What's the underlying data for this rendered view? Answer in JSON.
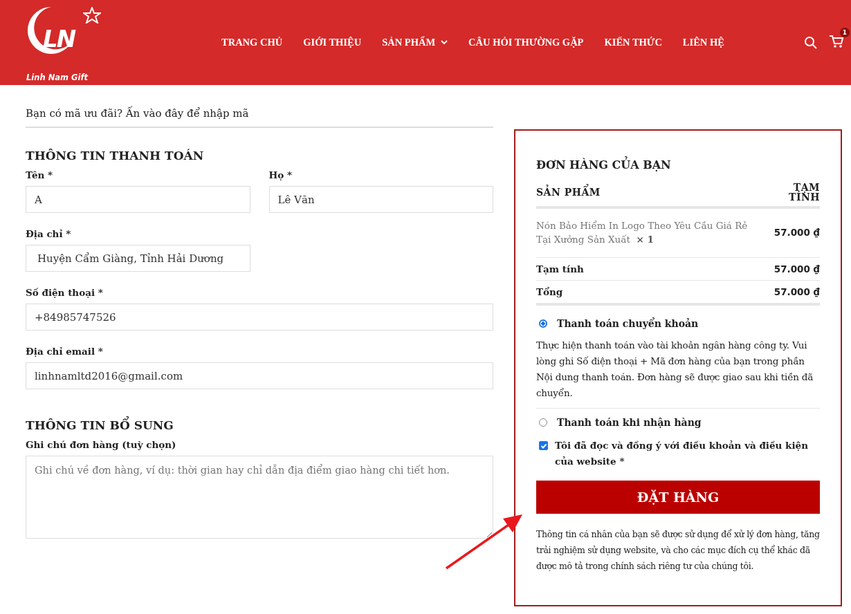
{
  "header": {
    "logo": {
      "mark": "LN",
      "name": "Linh Nam Gift"
    },
    "nav": [
      {
        "label": "TRANG CHỦ",
        "has_dropdown": false
      },
      {
        "label": "GIỚI THIỆU",
        "has_dropdown": false
      },
      {
        "label": "SẢN PHẨM",
        "has_dropdown": true
      },
      {
        "label": "CÂU HỎI THƯỜNG GẶP",
        "has_dropdown": false
      },
      {
        "label": "KIẾN THỨC",
        "has_dropdown": false
      },
      {
        "label": "LIÊN HỆ",
        "has_dropdown": false
      }
    ],
    "cart_count": "1"
  },
  "coupon_notice": "Bạn có mã ưu đãi? Ấn vào đây để nhập mã",
  "billing": {
    "title": "THÔNG TIN THANH TOÁN",
    "fields": [
      {
        "label": "Tên *",
        "value": "A"
      },
      {
        "label": "Họ *",
        "value": "Lê Văn"
      },
      {
        "label": "Địa chỉ *",
        "value": "Huyện Cẩm Giàng, Tỉnh Hải Dương"
      },
      {
        "label": "Số điện thoại *",
        "value": "+84985747526"
      },
      {
        "label": "Địa chỉ email *",
        "value": "linhnamltd2016@gmail.com"
      }
    ]
  },
  "additional": {
    "title": "THÔNG TIN BỔ SUNG",
    "notes": {
      "label": "Ghi chú đơn hàng (tuỳ chọn)",
      "placeholder": "Ghi chú về đơn hàng, ví dụ: thời gian hay chỉ dẫn địa điểm giao hàng chi tiết hơn."
    }
  },
  "order": {
    "title": "ĐƠN HÀNG CỦA BẠN",
    "columns": [
      "SẢN PHẨM",
      "TẠM TÍNH"
    ],
    "items": [
      {
        "name": "Nón Bảo Hiểm In Logo Theo Yêu Cầu Giá Rẻ Tại Xưởng Sản Xuất",
        "qty": "× 1",
        "price": "57.000 ₫"
      }
    ],
    "subtotal": {
      "label": "Tạm tính",
      "value": "57.000 ₫"
    },
    "total": {
      "label": "Tổng",
      "value": "57.000 ₫"
    }
  },
  "payment_methods": [
    {
      "label": "Thanh toán chuyển khoản",
      "selected": true,
      "description": "Thực hiện thanh toán vào tài khoản ngân hàng công ty. Vui lòng ghi Số điện thoại + Mã đơn hàng của bạn trong phần Nội dung thanh toán. Đơn hàng sẽ được giao sau khi tiền đã chuyển."
    },
    {
      "label": "Thanh toán khi nhận hàng",
      "selected": false
    }
  ],
  "terms": {
    "text": "Tôi đã đọc và đồng ý với điều khoản và điều kiện của website *",
    "checked": true
  },
  "place_order": "ĐẶT HÀNG",
  "privacy_note": "Thông tin cá nhân của bạn sẽ được sử dụng để xử lý đơn hàng, tăng trải nghiệm sử dụng website, và cho các mục đích cụ thể khác đã được mô tả trong chính sách riêng tư của chúng tôi."
}
